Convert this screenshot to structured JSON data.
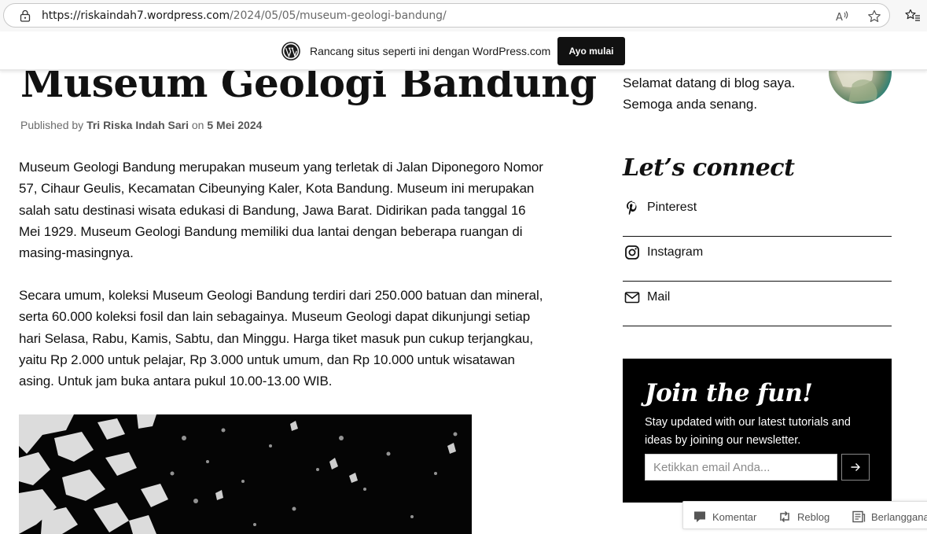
{
  "browser": {
    "url_host": "https://riskaindah7.wordpress.com",
    "url_path": "/2024/05/05/museum-geologi-bandung/"
  },
  "banner": {
    "text": "Rancang situs seperti ini dengan WordPress.com",
    "cta_label": "Ayo mulai"
  },
  "post": {
    "title": "Museum Geologi Bandung",
    "meta_published": "Published by",
    "author": "Tri Riska Indah Sari",
    "meta_on": "on",
    "date": "5 Mei 2024",
    "paragraphs": [
      "Museum Geologi Bandung merupakan museum yang terletak di Jalan Diponegoro Nomor 57, Cihaur Geulis, Kecamatan Cibeunying Kaler, Kota Bandung. Museum ini merupakan salah satu destinasi wisata edukasi di Bandung, Jawa Barat. Didirikan pada tanggal 16 Mei 1929. Museum Geologi Bandung memiliki dua lantai dengan beberapa ruangan di masing-masingnya.",
      "Secara umum, koleksi Museum Geologi Bandung terdiri dari 250.000 batuan dan mineral, serta 60.000 koleksi fosil dan lain sebagainya. Museum Geologi dapat dikunjungi setiap hari Selasa, Rabu, Kamis, Sabtu, dan Minggu. Harga tiket masuk pun cukup terjangkau, yaitu Rp 2.000 untuk pelajar, Rp 3.000 untuk umum, dan Rp 10.000 untuk wisatawan asing. Untuk jam buka antara pukul 10.00-13.00 WIB."
    ]
  },
  "sidebar": {
    "about_text": "Selamat datang di blog saya. Semoga anda senang.",
    "connect_title": "Let’s connect",
    "social": [
      {
        "label": "Pinterest",
        "icon": "pinterest-icon"
      },
      {
        "label": "Instagram",
        "icon": "instagram-icon"
      },
      {
        "label": "Mail",
        "icon": "mail-icon"
      }
    ],
    "newsletter": {
      "title": "Join the fun!",
      "description": "Stay updated with our latest tutorials and ideas by joining our newsletter.",
      "email_placeholder": "Ketikkan email Anda..."
    }
  },
  "action_bar": {
    "comment": "Komentar",
    "reblog": "Reblog",
    "subscribe": "Berlangganan"
  },
  "colors": {
    "cta_bg": "#111111",
    "newsletter_bg": "#000000",
    "avatar_teal": "#1d7f7a"
  }
}
